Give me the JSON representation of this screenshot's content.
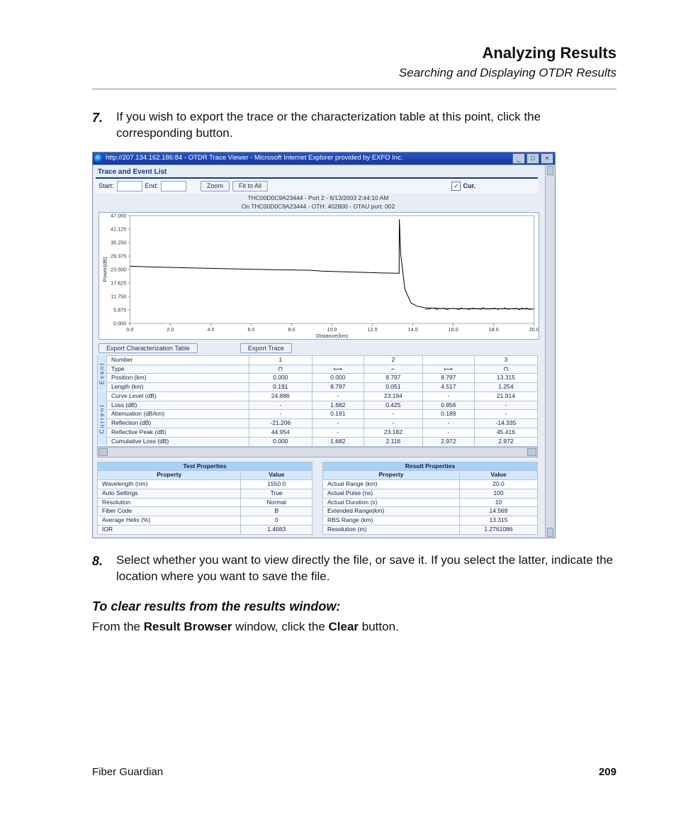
{
  "doc": {
    "chapter_title": "Analyzing Results",
    "chapter_subtitle": "Searching and Displaying OTDR Results",
    "product": "Fiber Guardian",
    "page_number": "209"
  },
  "steps": {
    "s7_num": "7.",
    "s7": "If you wish to export the trace or the characterization table at this point, click the corresponding button.",
    "s8_num": "8.",
    "s8": "Select whether you want to view directly the file, or save it. If you select the latter, indicate the location where you want to save the file.",
    "clear_heading": "To clear results from the results window:",
    "clear_pre": "From the ",
    "clear_b1": "Result Browser",
    "clear_mid": " window, click the ",
    "clear_b2": "Clear",
    "clear_post": " button."
  },
  "shot": {
    "window_title": "http://207.134.162.186:84 - OTDR Trace Viewer - Microsoft Internet Explorer provided by EXFO Inc.",
    "panel_title": "Trace and Event List",
    "params": {
      "start_label": "Start:",
      "end_label": "End:",
      "zoom_btn": "Zoom",
      "fit_btn": "Fit to All",
      "cur_label": "Cur."
    },
    "caption1": "THC00D0C9A23444 - Port 2 - 6/13/2003 2:44:10 AM",
    "caption2": "On THC00D0C9A23444 - OTH: 402800 - OTAU port: 002",
    "btns": {
      "export_table": "Export Characterization Table",
      "export_trace": "Export Trace"
    },
    "char_table": {
      "group_event": "Event",
      "group_current": "Current",
      "rows": {
        "number": {
          "label": "Number",
          "v": [
            "1",
            "",
            "2",
            "",
            "3"
          ]
        },
        "type": {
          "label": "Type",
          "v": [
            "⊓",
            "⟼",
            "⌐",
            "⟼",
            "⊓"
          ]
        },
        "position": {
          "label": "Position (km)",
          "v": [
            "0.000",
            "0.000",
            "8.797",
            "8.797",
            "13.315"
          ]
        },
        "length": {
          "label": "Length (km)",
          "v": [
            "0.191",
            "8.797",
            "0.051",
            "4.517",
            "1.254"
          ]
        },
        "curve": {
          "label": "Curve Level (dB)",
          "v": [
            "24.886",
            "-",
            "23.194",
            "-",
            "21.914"
          ]
        },
        "loss": {
          "label": "Loss (dB)",
          "v": [
            "-",
            "1.682",
            "0.425",
            "0.856",
            "-"
          ]
        },
        "atten": {
          "label": "Attenuation (dB/km)",
          "v": [
            "-",
            "0.191",
            "-",
            "0.189",
            "-"
          ]
        },
        "refl": {
          "label": "Reflection (dB)",
          "v": [
            "-21.206",
            "-",
            "-",
            "-",
            "-14.335"
          ]
        },
        "peak": {
          "label": "Reflective Peak (dB)",
          "v": [
            "44.954",
            "-",
            "23.182",
            "-",
            "45.416"
          ]
        },
        "cum": {
          "label": "Cumulative Loss (dB)",
          "v": [
            "0.000",
            "1.682",
            "2.116",
            "2.972",
            "2.972"
          ]
        }
      }
    },
    "test_props": {
      "heading": "Test Properties",
      "col_property": "Property",
      "col_value": "Value",
      "rows": [
        [
          "Wavelength (nm)",
          "1550.0"
        ],
        [
          "Auto Settings",
          "True"
        ],
        [
          "Resolution",
          "Normal"
        ],
        [
          "Fiber Code",
          "B"
        ],
        [
          "Average Helix (%)",
          "0"
        ],
        [
          "IOR",
          "1.4683"
        ]
      ]
    },
    "result_props": {
      "heading": "Result Properties",
      "col_property": "Property",
      "col_value": "Value",
      "rows": [
        [
          "Actual Range (km)",
          "20.0"
        ],
        [
          "Actual Pulse (ns)",
          "100"
        ],
        [
          "Actual Duration (s)",
          "10"
        ],
        [
          "Extended Range(km)",
          "14.569"
        ],
        [
          "RBS Range (km)",
          "13.315"
        ],
        [
          "Resolution (m)",
          "1.2761086"
        ]
      ]
    }
  },
  "chart_data": {
    "type": "line",
    "title": "",
    "xlabel": "Distance(km)",
    "ylabel": "Power(dB)",
    "xlim": [
      0,
      20
    ],
    "ylim": [
      0,
      47
    ],
    "x_ticks": [
      0,
      2,
      4,
      6,
      8,
      10,
      12,
      14,
      16,
      18,
      20
    ],
    "y_ticks": [
      0,
      5.875,
      11.75,
      17.625,
      23.5,
      29.375,
      35.25,
      41.125,
      47.0
    ],
    "series": [
      {
        "name": "trace",
        "x": [
          0.0,
          0.19,
          1.0,
          3.0,
          5.0,
          7.0,
          8.8,
          8.85,
          9.5,
          11.0,
          12.5,
          13.32,
          13.33,
          13.4,
          13.6,
          13.9,
          14.2,
          14.6,
          15.5,
          17.0,
          18.5,
          20.0
        ],
        "y": [
          24.9,
          24.9,
          24.6,
          24.2,
          23.8,
          23.4,
          23.2,
          23.2,
          22.8,
          22.4,
          22.0,
          21.9,
          45.4,
          30.0,
          15.0,
          9.0,
          7.5,
          6.8,
          6.5,
          6.4,
          6.4,
          6.3
        ]
      }
    ]
  }
}
